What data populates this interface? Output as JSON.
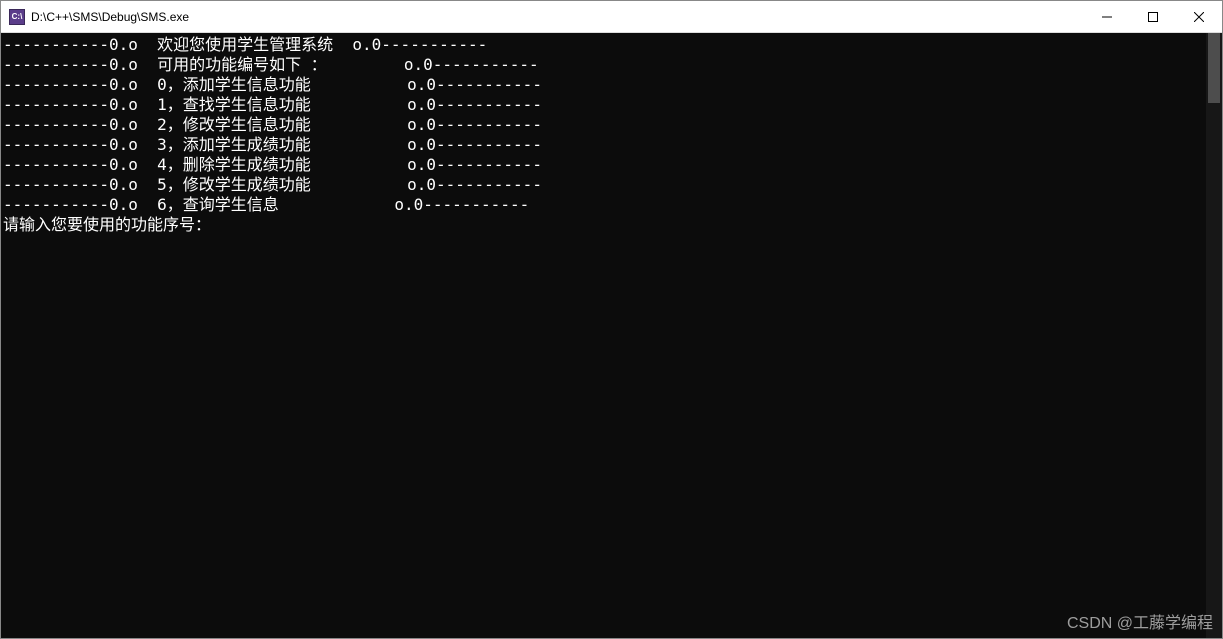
{
  "window": {
    "title": "D:\\C++\\SMS\\Debug\\SMS.exe",
    "icon_label": "C:\\"
  },
  "console": {
    "lines": [
      "-----------0.o  欢迎您使用学生管理系统  o.0-----------",
      "-----------0.o  可用的功能编号如下 ：        o.0-----------",
      "-----------0.o  0，添加学生信息功能          o.0-----------",
      "-----------0.o  1，查找学生信息功能          o.0-----------",
      "-----------0.o  2，修改学生信息功能          o.0-----------",
      "-----------0.o  3，添加学生成绩功能          o.0-----------",
      "-----------0.o  4，删除学生成绩功能          o.0-----------",
      "-----------0.o  5，修改学生成绩功能          o.0-----------",
      "-----------0.o  6，查询学生信息            o.0-----------",
      "请输入您要使用的功能序号："
    ]
  },
  "watermark": "CSDN @工藤学编程"
}
